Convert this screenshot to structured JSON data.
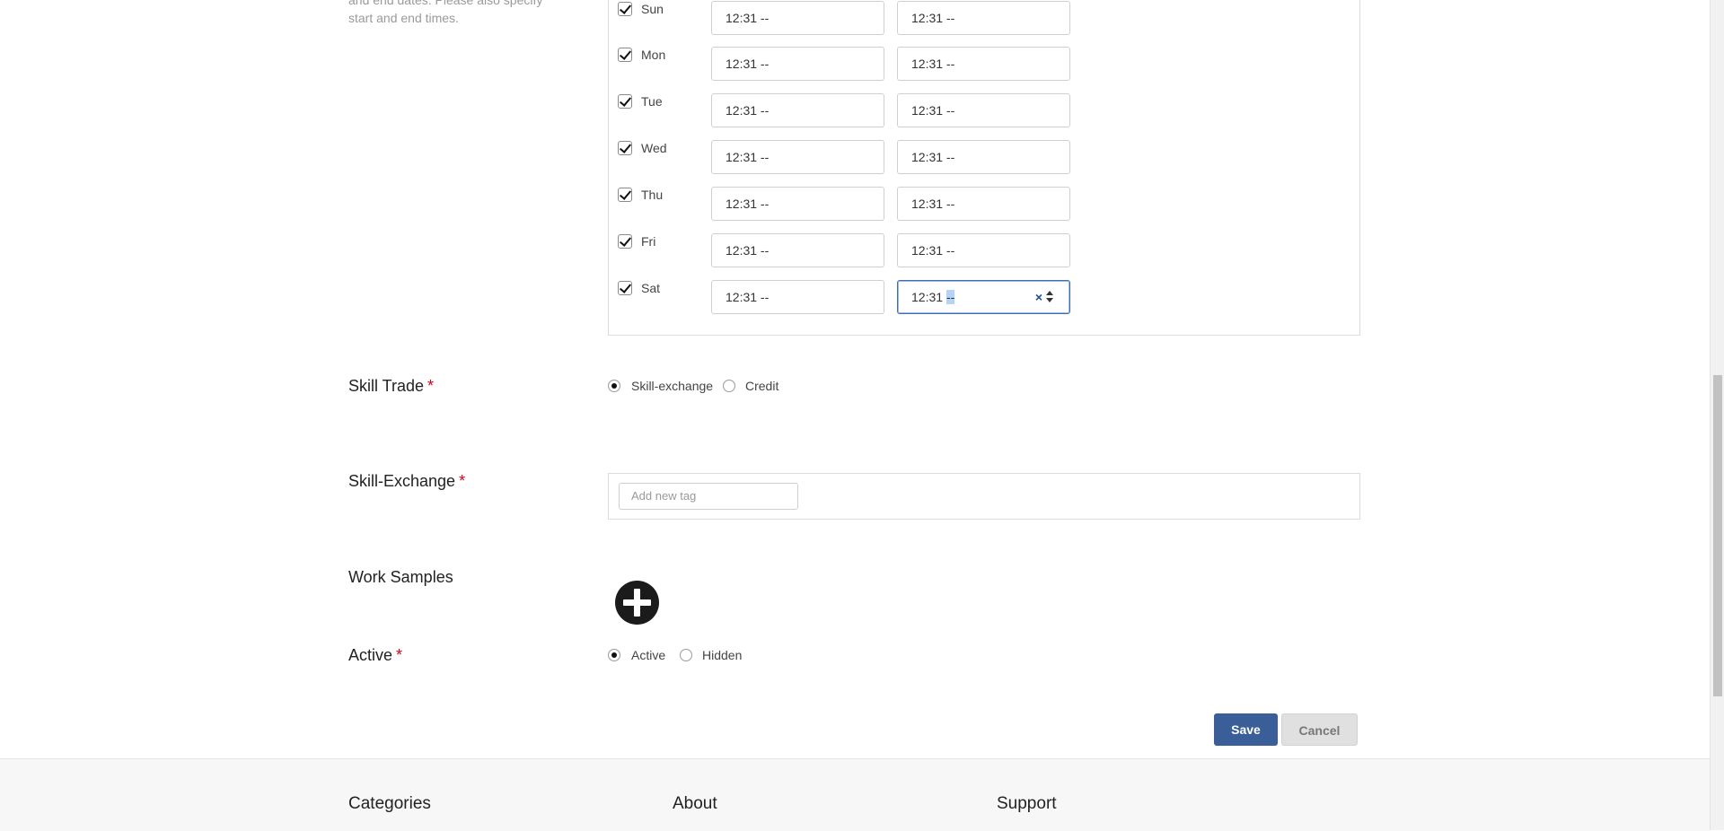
{
  "availability": {
    "hint_text": "and end dates. Please also specify start and end times.",
    "days": [
      {
        "label": "Sun",
        "checked": true,
        "start": "12:31 --",
        "end": "12:31 --"
      },
      {
        "label": "Mon",
        "checked": true,
        "start": "12:31 --",
        "end": "12:31 --"
      },
      {
        "label": "Tue",
        "checked": true,
        "start": "12:31 --",
        "end": "12:31 --"
      },
      {
        "label": "Wed",
        "checked": true,
        "start": "12:31 --",
        "end": "12:31 --"
      },
      {
        "label": "Thu",
        "checked": true,
        "start": "12:31 --",
        "end": "12:31 --"
      },
      {
        "label": "Fri",
        "checked": true,
        "start": "12:31 --",
        "end": "12:31 --"
      },
      {
        "label": "Sat",
        "checked": true,
        "start": "12:31 --",
        "end_time": "12:31",
        "end_ampm": "--"
      }
    ],
    "clear_glyph": "×"
  },
  "skill_trade": {
    "label": "Skill Trade",
    "required_mark": "*",
    "options": [
      "Skill-exchange",
      "Credit"
    ],
    "selected": "Skill-exchange"
  },
  "skill_exchange": {
    "label": "Skill-Exchange",
    "required_mark": "*",
    "tag_placeholder": "Add new tag"
  },
  "work_samples": {
    "label": "Work Samples",
    "add_icon": "plus-circle-icon"
  },
  "active": {
    "label": "Active",
    "required_mark": "*",
    "options": [
      "Active",
      "Hidden"
    ],
    "selected": "Active"
  },
  "actions": {
    "save_label": "Save",
    "cancel_label": "Cancel"
  },
  "footer": {
    "headings": [
      "Categories",
      "About",
      "Support"
    ]
  },
  "colors": {
    "save_bg": "#3a5e97",
    "required": "#d0021b",
    "focus_border": "#3d6eb5"
  }
}
